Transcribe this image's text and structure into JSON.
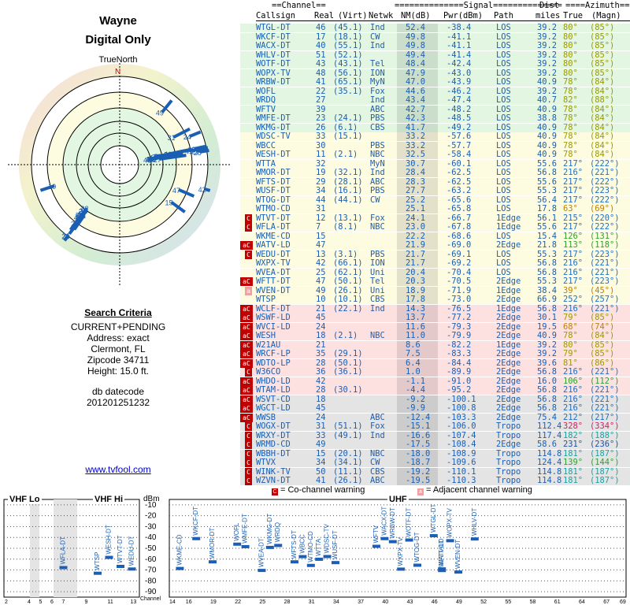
{
  "header": {
    "location": "Wayne",
    "mode": "Digital Only",
    "north": "TrueNorth",
    "n_mark": "N"
  },
  "criteria": {
    "heading": "Search Criteria",
    "lines": [
      "CURRENT+PENDING",
      "Address: exact",
      "Clermont, FL",
      "Zipcode 34711",
      "Height: 15.0 ft."
    ],
    "db_label": "db datecode",
    "db_value": "201201251232"
  },
  "footer_link": "www.tvfool.com",
  "table_header": {
    "top": [
      "==Channel==",
      "==============Signal==============",
      "Dist",
      "====Azimuth===="
    ],
    "cols": [
      "Callsign",
      "Real",
      "(Virt)",
      "Netwk",
      "NM(dB)",
      "Pwr(dBm)",
      "Path",
      "miles",
      "True",
      "(Magn)"
    ]
  },
  "stations": [
    {
      "call": "WTGL-DT",
      "real": "46",
      "virt": "(45.1)",
      "net": "Ind",
      "nm": "52.4",
      "pwr": "-38.4",
      "path": "LOS",
      "dist": "39.2",
      "az": "80°",
      "mag": "(85°)",
      "bg": "#e2f6e2",
      "cc": "#9a9a00",
      "w": ""
    },
    {
      "call": "WKCF-DT",
      "real": "17",
      "virt": "(18.1)",
      "net": "CW",
      "nm": "49.8",
      "pwr": "-41.1",
      "path": "LOS",
      "dist": "39.2",
      "az": "80°",
      "mag": "(85°)",
      "bg": "#e2f6e2",
      "cc": "#9a9a00",
      "w": ""
    },
    {
      "call": "WACX-DT",
      "real": "40",
      "virt": "(55.1)",
      "net": "Ind",
      "nm": "49.8",
      "pwr": "-41.1",
      "path": "LOS",
      "dist": "39.2",
      "az": "80°",
      "mag": "(85°)",
      "bg": "#e2f6e2",
      "cc": "#9a9a00",
      "w": ""
    },
    {
      "call": "WHLV-DT",
      "real": "51",
      "virt": "(52.1)",
      "net": "",
      "nm": "49.4",
      "pwr": "-41.4",
      "path": "LOS",
      "dist": "39.2",
      "az": "80°",
      "mag": "(85°)",
      "bg": "#e2f6e2",
      "cc": "#9a9a00",
      "w": ""
    },
    {
      "call": "WOTF-DT",
      "real": "43",
      "virt": "(43.1)",
      "net": "Tel",
      "nm": "48.4",
      "pwr": "-42.4",
      "path": "LOS",
      "dist": "39.2",
      "az": "80°",
      "mag": "(85°)",
      "bg": "#e2f6e2",
      "cc": "#9a9a00",
      "w": ""
    },
    {
      "call": "WOPX-TV",
      "real": "48",
      "virt": "(56.1)",
      "net": "ION",
      "nm": "47.9",
      "pwr": "-43.0",
      "path": "LOS",
      "dist": "39.2",
      "az": "80°",
      "mag": "(85°)",
      "bg": "#e2f6e2",
      "cc": "#9a9a00",
      "w": ""
    },
    {
      "call": "WRBW-DT",
      "real": "41",
      "virt": "(65.1)",
      "net": "MyN",
      "nm": "47.0",
      "pwr": "-43.9",
      "path": "LOS",
      "dist": "40.9",
      "az": "78°",
      "mag": "(84°)",
      "bg": "#e2f6e2",
      "cc": "#9a9a00",
      "w": ""
    },
    {
      "call": "WOFL",
      "real": "22",
      "virt": "(35.1)",
      "net": "Fox",
      "nm": "44.6",
      "pwr": "-46.2",
      "path": "LOS",
      "dist": "39.2",
      "az": "78°",
      "mag": "(84°)",
      "bg": "#e2f6e2",
      "cc": "#9a9a00",
      "w": ""
    },
    {
      "call": "WRDQ",
      "real": "27",
      "virt": "",
      "net": "Ind",
      "nm": "43.4",
      "pwr": "-47.4",
      "path": "LOS",
      "dist": "40.7",
      "az": "82°",
      "mag": "(88°)",
      "bg": "#e2f6e2",
      "cc": "#9a9a00",
      "w": ""
    },
    {
      "call": "WFTV",
      "real": "39",
      "virt": "",
      "net": "ABC",
      "nm": "42.7",
      "pwr": "-48.2",
      "path": "LOS",
      "dist": "40.9",
      "az": "78°",
      "mag": "(84°)",
      "bg": "#e2f6e2",
      "cc": "#9a9a00",
      "w": ""
    },
    {
      "call": "WMFE-DT",
      "real": "23",
      "virt": "(24.1)",
      "net": "PBS",
      "nm": "42.3",
      "pwr": "-48.5",
      "path": "LOS",
      "dist": "38.8",
      "az": "78°",
      "mag": "(84°)",
      "bg": "#e2f6e2",
      "cc": "#9a9a00",
      "w": ""
    },
    {
      "call": "WKMG-DT",
      "real": "26",
      "virt": "(6.1)",
      "net": "CBS",
      "nm": "41.7",
      "pwr": "-49.2",
      "path": "LOS",
      "dist": "40.9",
      "az": "78°",
      "mag": "(84°)",
      "bg": "#e2f6e2",
      "cc": "#9a9a00",
      "w": ""
    },
    {
      "call": "WDSC-TV",
      "real": "33",
      "virt": "(15.1)",
      "net": "",
      "nm": "33.2",
      "pwr": "-57.6",
      "path": "LOS",
      "dist": "40.9",
      "az": "78°",
      "mag": "(84°)",
      "bg": "#fdfbe0",
      "cc": "#9a9a00",
      "w": ""
    },
    {
      "call": "WBCC",
      "real": "30",
      "virt": "",
      "net": "PBS",
      "nm": "33.2",
      "pwr": "-57.7",
      "path": "LOS",
      "dist": "40.9",
      "az": "78°",
      "mag": "(84°)",
      "bg": "#fdfbe0",
      "cc": "#9a9a00",
      "w": ""
    },
    {
      "call": "WESH-DT",
      "real": "11",
      "virt": "(2.1)",
      "net": "NBC",
      "nm": "32.5",
      "pwr": "-58.4",
      "path": "LOS",
      "dist": "40.9",
      "az": "78°",
      "mag": "(84°)",
      "bg": "#fdfbe0",
      "cc": "#9a9a00",
      "w": ""
    },
    {
      "call": "WTTA",
      "real": "32",
      "virt": "",
      "net": "MyN",
      "nm": "30.7",
      "pwr": "-60.1",
      "path": "LOS",
      "dist": "55.6",
      "az": "217°",
      "mag": "(222°)",
      "bg": "#fdfbe0",
      "cc": "#2070c0",
      "w": ""
    },
    {
      "call": "WMOR-DT",
      "real": "19",
      "virt": "(32.1)",
      "net": "Ind",
      "nm": "28.4",
      "pwr": "-62.5",
      "path": "LOS",
      "dist": "56.8",
      "az": "216°",
      "mag": "(221°)",
      "bg": "#fdfbe0",
      "cc": "#2070c0",
      "w": ""
    },
    {
      "call": "WFTS-DT",
      "real": "29",
      "virt": "(28.1)",
      "net": "ABC",
      "nm": "28.3",
      "pwr": "-62.5",
      "path": "LOS",
      "dist": "55.6",
      "az": "217°",
      "mag": "(222°)",
      "bg": "#fdfbe0",
      "cc": "#2070c0",
      "w": ""
    },
    {
      "call": "WUSF-DT",
      "real": "34",
      "virt": "(16.1)",
      "net": "PBS",
      "nm": "27.7",
      "pwr": "-63.2",
      "path": "LOS",
      "dist": "55.3",
      "az": "217°",
      "mag": "(223°)",
      "bg": "#fdfbe0",
      "cc": "#2070c0",
      "w": ""
    },
    {
      "call": "WTOG-DT",
      "real": "44",
      "virt": "(44.1)",
      "net": "CW",
      "nm": "25.2",
      "pwr": "-65.6",
      "path": "LOS",
      "dist": "56.4",
      "az": "217°",
      "mag": "(222°)",
      "bg": "#fdfbe0",
      "cc": "#2070c0",
      "w": ""
    },
    {
      "call": "WTMO-CD",
      "real": "31",
      "virt": "",
      "net": "",
      "nm": "25.1",
      "pwr": "-65.8",
      "path": "LOS",
      "dist": "17.8",
      "az": "63°",
      "mag": "(69°)",
      "bg": "#fdfbe0",
      "cc": "#c08000",
      "w": ""
    },
    {
      "call": "WTVT-DT",
      "real": "12",
      "virt": "(13.1)",
      "net": "Fox",
      "nm": "24.1",
      "pwr": "-66.7",
      "path": "1Edge",
      "dist": "56.1",
      "az": "215°",
      "mag": "(220°)",
      "bg": "#fdfbe0",
      "cc": "#2070c0",
      "w": "C"
    },
    {
      "call": "WFLA-DT",
      "real": "7",
      "virt": "(8.1)",
      "net": "NBC",
      "nm": "23.0",
      "pwr": "-67.8",
      "path": "1Edge",
      "dist": "55.6",
      "az": "217°",
      "mag": "(222°)",
      "bg": "#fdfbe0",
      "cc": "#2070c0",
      "w": "C"
    },
    {
      "call": "WKME-CD",
      "real": "15",
      "virt": "",
      "net": "",
      "nm": "22.2",
      "pwr": "-68.6",
      "path": "LOS",
      "dist": "15.4",
      "az": "126°",
      "mag": "(131°)",
      "bg": "#fdfbe0",
      "cc": "#30a030",
      "w": ""
    },
    {
      "call": "WATV-LD",
      "real": "47",
      "virt": "",
      "net": "",
      "nm": "21.9",
      "pwr": "-69.0",
      "path": "2Edge",
      "dist": "21.8",
      "az": "113°",
      "mag": "(118°)",
      "bg": "#fdfbe0",
      "cc": "#30a030",
      "w": "aC"
    },
    {
      "call": "WEDU-DT",
      "real": "13",
      "virt": "(3.1)",
      "net": "PBS",
      "nm": "21.7",
      "pwr": "-69.1",
      "path": "LOS",
      "dist": "55.3",
      "az": "217°",
      "mag": "(223°)",
      "bg": "#fdfbe0",
      "cc": "#2070c0",
      "w": "C"
    },
    {
      "call": "WXPX-TV",
      "real": "42",
      "virt": "(66.1)",
      "net": "ION",
      "nm": "21.7",
      "pwr": "-69.2",
      "path": "LOS",
      "dist": "56.8",
      "az": "216°",
      "mag": "(221°)",
      "bg": "#fdfbe0",
      "cc": "#2070c0",
      "w": ""
    },
    {
      "call": "WVEA-DT",
      "real": "25",
      "virt": "(62.1)",
      "net": "Uni",
      "nm": "20.4",
      "pwr": "-70.4",
      "path": "LOS",
      "dist": "56.8",
      "az": "216°",
      "mag": "(221°)",
      "bg": "#fdfbe0",
      "cc": "#2070c0",
      "w": ""
    },
    {
      "call": "WFTT-DT",
      "real": "47",
      "virt": "(50.1)",
      "net": "Tel",
      "nm": "20.3",
      "pwr": "-70.5",
      "path": "2Edge",
      "dist": "55.3",
      "az": "217°",
      "mag": "(223°)",
      "bg": "#fdfbe0",
      "cc": "#2070c0",
      "w": "aC"
    },
    {
      "call": "WVEN-DT",
      "real": "49",
      "virt": "(26.1)",
      "net": "Uni",
      "nm": "18.9",
      "pwr": "-71.9",
      "path": "1Edge",
      "dist": "38.4",
      "az": "39°",
      "mag": "(45°)",
      "bg": "#fdfbe0",
      "cc": "#c08000",
      "w": "a"
    },
    {
      "call": "WTSP",
      "real": "10",
      "virt": "(10.1)",
      "net": "CBS",
      "nm": "17.8",
      "pwr": "-73.0",
      "path": "2Edge",
      "dist": "66.9",
      "az": "252°",
      "mag": "(257°)",
      "bg": "#fdfbe0",
      "cc": "#2070c0",
      "w": ""
    },
    {
      "call": "WCLF-DT",
      "real": "21",
      "virt": "(22.1)",
      "net": "Ind",
      "nm": "14.3",
      "pwr": "-76.5",
      "path": "1Edge",
      "dist": "56.8",
      "az": "216°",
      "mag": "(221°)",
      "bg": "#fde0e0",
      "cc": "#2070c0",
      "w": "aC"
    },
    {
      "call": "WSWF-LD",
      "real": "45",
      "virt": "",
      "net": "",
      "nm": "13.7",
      "pwr": "-77.2",
      "path": "2Edge",
      "dist": "30.1",
      "az": "79°",
      "mag": "(85°)",
      "bg": "#fde0e0",
      "cc": "#9a9a00",
      "w": "aC"
    },
    {
      "call": "WVCI-LD",
      "real": "24",
      "virt": "",
      "net": "",
      "nm": "11.6",
      "pwr": "-79.3",
      "path": "2Edge",
      "dist": "19.5",
      "az": "68°",
      "mag": "(74°)",
      "bg": "#fde0e0",
      "cc": "#c08000",
      "w": "aC"
    },
    {
      "call": "WESH",
      "real": "18",
      "virt": "(2.1)",
      "net": "NBC",
      "nm": "11.0",
      "pwr": "-79.9",
      "path": "2Edge",
      "dist": "40.9",
      "az": "78°",
      "mag": "(84°)",
      "bg": "#fde0e0",
      "cc": "#9a9a00",
      "w": "aC"
    },
    {
      "call": "W21AU",
      "real": "21",
      "virt": "",
      "net": "",
      "nm": "8.6",
      "pwr": "-82.2",
      "path": "1Edge",
      "dist": "39.2",
      "az": "80°",
      "mag": "(85°)",
      "bg": "#fde0e0",
      "cc": "#9a9a00",
      "w": "aC"
    },
    {
      "call": "WRCF-LP",
      "real": "35",
      "virt": "(29.1)",
      "net": "",
      "nm": "7.5",
      "pwr": "-83.3",
      "path": "2Edge",
      "dist": "39.2",
      "az": "79°",
      "mag": "(85°)",
      "bg": "#fde0e0",
      "cc": "#9a9a00",
      "w": "aC"
    },
    {
      "call": "WDTO-LP",
      "real": "28",
      "virt": "(50.1)",
      "net": "",
      "nm": "6.4",
      "pwr": "-84.4",
      "path": "2Edge",
      "dist": "39.6",
      "az": "81°",
      "mag": "(86°)",
      "bg": "#fde0e0",
      "cc": "#9a9a00",
      "w": "aC"
    },
    {
      "call": "W36CO",
      "real": "36",
      "virt": "(36.1)",
      "net": "",
      "nm": "1.0",
      "pwr": "-89.9",
      "path": "2Edge",
      "dist": "56.8",
      "az": "216°",
      "mag": "(221°)",
      "bg": "#fde0e0",
      "cc": "#2070c0",
      "w": "C"
    },
    {
      "call": "WHDO-LD",
      "real": "42",
      "virt": "",
      "net": "",
      "nm": "-1.1",
      "pwr": "-91.0",
      "path": "2Edge",
      "dist": "16.0",
      "az": "106°",
      "mag": "(112°)",
      "bg": "#fde0e0",
      "cc": "#30a030",
      "w": "aC"
    },
    {
      "call": "WTAM-LD",
      "real": "28",
      "virt": "(30.1)",
      "net": "",
      "nm": "-4.4",
      "pwr": "-95.2",
      "path": "2Edge",
      "dist": "56.8",
      "az": "216°",
      "mag": "(221°)",
      "bg": "#fde0e0",
      "cc": "#2070c0",
      "w": "aC"
    },
    {
      "call": "WSVT-CD",
      "real": "18",
      "virt": "",
      "net": "",
      "nm": "-9.2",
      "pwr": "-100.1",
      "path": "2Edge",
      "dist": "56.8",
      "az": "216°",
      "mag": "(221°)",
      "bg": "#e4e4e4",
      "cc": "#2070c0",
      "w": "aC"
    },
    {
      "call": "WGCT-LD",
      "real": "45",
      "virt": "",
      "net": "",
      "nm": "-9.9",
      "pwr": "-100.8",
      "path": "2Edge",
      "dist": "56.8",
      "az": "216°",
      "mag": "(221°)",
      "bg": "#e4e4e4",
      "cc": "#2070c0",
      "w": "aC"
    },
    {
      "call": "WWSB",
      "real": "24",
      "virt": "",
      "net": "ABC",
      "nm": "-12.4",
      "pwr": "-103.3",
      "path": "2Edge",
      "dist": "75.4",
      "az": "212°",
      "mag": "(217°)",
      "bg": "#e4e4e4",
      "cc": "#2070c0",
      "w": "aC"
    },
    {
      "call": "WOGX-DT",
      "real": "31",
      "virt": "(51.1)",
      "net": "Fox",
      "nm": "-15.1",
      "pwr": "-106.0",
      "path": "Tropo",
      "dist": "112.4",
      "az": "328°",
      "mag": "(334°)",
      "bg": "#e4e4e4",
      "cc": "#d02060",
      "w": "C"
    },
    {
      "call": "WRXY-DT",
      "real": "33",
      "virt": "(49.1)",
      "net": "Ind",
      "nm": "-16.6",
      "pwr": "-107.4",
      "path": "Tropo",
      "dist": "117.4",
      "az": "182°",
      "mag": "(188°)",
      "bg": "#e4e4e4",
      "cc": "#20a0a0",
      "w": "C"
    },
    {
      "call": "WRMD-CD",
      "real": "49",
      "virt": "",
      "net": "",
      "nm": "-17.5",
      "pwr": "-108.4",
      "path": "2Edge",
      "dist": "58.6",
      "az": "231°",
      "mag": "(236°)",
      "bg": "#e4e4e4",
      "cc": "#2050a0",
      "w": "C"
    },
    {
      "call": "WBBH-DT",
      "real": "15",
      "virt": "(20.1)",
      "net": "NBC",
      "nm": "-18.0",
      "pwr": "-108.9",
      "path": "Tropo",
      "dist": "114.8",
      "az": "181°",
      "mag": "(187°)",
      "bg": "#e4e4e4",
      "cc": "#20a0a0",
      "w": "C"
    },
    {
      "call": "WTVX",
      "real": "34",
      "virt": "(34.1)",
      "net": "CW",
      "nm": "-18.7",
      "pwr": "-109.6",
      "path": "Tropo",
      "dist": "124.4",
      "az": "139°",
      "mag": "(144°)",
      "bg": "#e4e4e4",
      "cc": "#30a030",
      "w": "C"
    },
    {
      "call": "WINK-TV",
      "real": "50",
      "virt": "(11.1)",
      "net": "CBS",
      "nm": "-19.2",
      "pwr": "-110.1",
      "path": "Tropo",
      "dist": "114.8",
      "az": "181°",
      "mag": "(187°)",
      "bg": "#e4e4e4",
      "cc": "#20a0a0",
      "w": "C"
    },
    {
      "call": "WZVN-DT",
      "real": "41",
      "virt": "(26.1)",
      "net": "ABC",
      "nm": "-19.5",
      "pwr": "-110.3",
      "path": "Tropo",
      "dist": "114.8",
      "az": "181°",
      "mag": "(187°)",
      "bg": "#e4e4e4",
      "cc": "#20a0a0",
      "w": "C"
    }
  ],
  "legend": {
    "co": "= Co-channel warning",
    "adj": "= Adjacent channel warning",
    "co_mark": "C",
    "adj_mark": "a"
  },
  "spectrum": {
    "vhf_lo": "VHF Lo",
    "vhf_hi": "VHF Hi",
    "uhf": "UHF",
    "unit": "dBm",
    "dbm_ticks": [
      "-10",
      "-20",
      "-30",
      "-40",
      "-50",
      "-60",
      "-70",
      "-80",
      "-90"
    ],
    "vhf_ticks": [
      "2",
      "4",
      "5",
      "6",
      "7",
      "9",
      "11",
      "13"
    ],
    "uhf_ticks": [
      "14",
      "16",
      "19",
      "22",
      "25",
      "28",
      "31",
      "34",
      "37",
      "40",
      "43",
      "46",
      "49",
      "52",
      "55",
      "58",
      "61",
      "64",
      "67",
      "69"
    ],
    "channel_label": "Channel"
  },
  "chart_data": {
    "type": "scatter",
    "title": "",
    "xlabel": "Channel",
    "ylabel": "dBm",
    "ylim": [
      -95,
      -10
    ],
    "points": [
      {
        "label": "WTGL-DT",
        "ch": 46,
        "pwr": -38.4
      },
      {
        "label": "WKCF-DT",
        "ch": 17,
        "pwr": -41.1
      },
      {
        "label": "WACX-DT",
        "ch": 40,
        "pwr": -41.1
      },
      {
        "label": "WHLV-DT",
        "ch": 51,
        "pwr": -41.4
      },
      {
        "label": "WOTF-DT",
        "ch": 43,
        "pwr": -42.4
      },
      {
        "label": "WOPX-TV",
        "ch": 48,
        "pwr": -43.0
      },
      {
        "label": "WRBW-DT",
        "ch": 41,
        "pwr": -43.9
      },
      {
        "label": "WOFL",
        "ch": 22,
        "pwr": -46.2
      },
      {
        "label": "WRDQ",
        "ch": 27,
        "pwr": -47.4
      },
      {
        "label": "WFTV",
        "ch": 39,
        "pwr": -48.2
      },
      {
        "label": "WMFE-DT",
        "ch": 23,
        "pwr": -48.5
      },
      {
        "label": "WKMG-DT",
        "ch": 26,
        "pwr": -49.2
      },
      {
        "label": "WDSC-TV",
        "ch": 33,
        "pwr": -57.6
      },
      {
        "label": "WBCC",
        "ch": 30,
        "pwr": -57.7
      },
      {
        "label": "WESH-DT",
        "ch": 11,
        "pwr": -58.4
      },
      {
        "label": "WTTA",
        "ch": 32,
        "pwr": -60.1
      },
      {
        "label": "WMOR-DT",
        "ch": 19,
        "pwr": -62.5
      },
      {
        "label": "WFTS-DT",
        "ch": 29,
        "pwr": -62.5
      },
      {
        "label": "WUSF-DT",
        "ch": 34,
        "pwr": -63.2
      },
      {
        "label": "WTOG-DT",
        "ch": 44,
        "pwr": -65.6
      },
      {
        "label": "WTMO-CD",
        "ch": 31,
        "pwr": -65.8
      },
      {
        "label": "WTVT-DT",
        "ch": 12,
        "pwr": -66.7
      },
      {
        "label": "WFLA-DT",
        "ch": 7,
        "pwr": -67.8
      },
      {
        "label": "WKME-CD",
        "ch": 15,
        "pwr": -68.6
      },
      {
        "label": "WATV-LD",
        "ch": 47,
        "pwr": -69.0
      },
      {
        "label": "WEDU-DT",
        "ch": 13,
        "pwr": -69.1
      },
      {
        "label": "WXPX-TV",
        "ch": 42,
        "pwr": -69.2
      },
      {
        "label": "WVEA-DT",
        "ch": 25,
        "pwr": -70.4
      },
      {
        "label": "WFTT-DT",
        "ch": 47,
        "pwr": -70.5
      },
      {
        "label": "WVEN-DT",
        "ch": 49,
        "pwr": -71.9
      },
      {
        "label": "WTSP",
        "ch": 10,
        "pwr": -73.0
      }
    ]
  }
}
